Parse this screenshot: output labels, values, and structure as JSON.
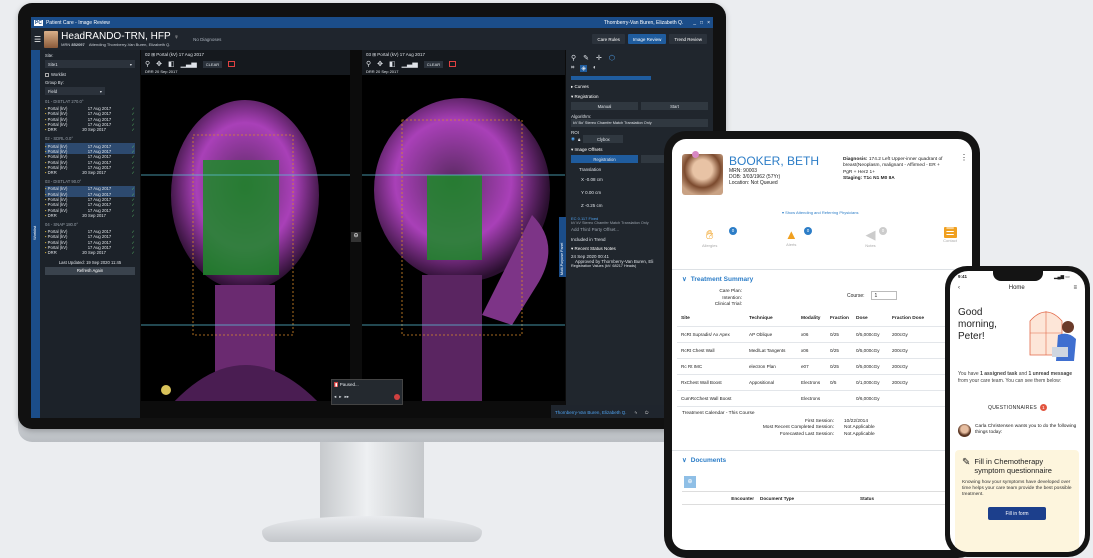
{
  "desktop": {
    "window_title": "Patient Care - Image Review",
    "title_user": "Thornberry-Van Buren, Elizabeth Q.",
    "app_logo": "PC",
    "patient": {
      "name": "HeadRANDO-TRN, HFP",
      "gender_symbol": "♀",
      "mrn_label": "MRN",
      "mrn": "852097",
      "attending_label": "Attending",
      "attending": "Thornberry-Van Buren, Elizabeth Q.",
      "diagnosis": "No Diagnoses"
    },
    "top_tabs": [
      "Care Rules",
      "Image Review",
      "Trend Review"
    ],
    "side": {
      "site_label": "Site:",
      "site_value": "Site1",
      "worklist": "Worklist",
      "group_by_label": "Group By:",
      "group_by_value": "Field",
      "groups": [
        {
          "title": "01 - DISTLAT 270.0°",
          "rows": [
            [
              "Portal (kV)",
              "17 Aug 2017"
            ],
            [
              "Portal (kV)",
              "17 Aug 2017"
            ],
            [
              "Portal (kV)",
              "17 Aug 2017"
            ],
            [
              "Portal (kV)",
              "17 Aug 2017"
            ],
            [
              "DRR",
              "20 Sep 2017"
            ]
          ]
        },
        {
          "title": "02 - SDRL 0.0°",
          "rows": [
            [
              "Portal (kV)",
              "17 Aug 2017"
            ],
            [
              "Portal (kV)",
              "17 Aug 2017"
            ],
            [
              "Portal (kV)",
              "17 Aug 2017"
            ],
            [
              "Portal (kV)",
              "17 Aug 2017"
            ],
            [
              "Portal (kV)",
              "17 Aug 2017"
            ],
            [
              "DRR",
              "20 Sep 2017"
            ]
          ]
        },
        {
          "title": "03 - DISTLAT 90.0°",
          "rows": [
            [
              "Portal (kV)",
              "17 Aug 2017"
            ],
            [
              "Portal (kV)",
              "17 Aug 2017"
            ],
            [
              "Portal (kV)",
              "17 Aug 2017"
            ],
            [
              "Portal (kV)",
              "17 Aug 2017"
            ],
            [
              "Portal (kV)",
              "17 Aug 2017"
            ],
            [
              "DRR",
              "20 Sep 2017"
            ]
          ]
        },
        {
          "title": "04 - SNAP 180.0°",
          "rows": [
            [
              "Portal (kV)",
              "17 Aug 2017"
            ],
            [
              "Portal (kV)",
              "17 Aug 2017"
            ],
            [
              "Portal (kV)",
              "17 Aug 2017"
            ],
            [
              "Portal (kV)",
              "17 Aug 2017"
            ],
            [
              "DRR",
              "20 Sep 2017"
            ]
          ]
        }
      ],
      "last_updated": "Last Updated: 19 Sep 2020 11:45",
      "refresh": "Refresh Again",
      "vertical_tab": "Worklist"
    },
    "viewer_left": {
      "header": "02  ⊞  Portal (kV)  17 Aug 2017",
      "drr": "DRR  20 Sep 2017",
      "clear": "CLEAR"
    },
    "viewer_right": {
      "header": "03  ⊞  Portal (kV)  17 Aug 2017",
      "drr": "DRR  20 Sep 2017",
      "clear": "CLEAR"
    },
    "paused": "Paused...",
    "status_user": "Thornberry-Van Buren, Elizabeth Q.",
    "right": {
      "vertical_tab": "Multi-Purpose Panel",
      "curves": "Curves",
      "registration": "Registration",
      "manual": "Manual",
      "start": "Start",
      "algorithm_label": "Algorithm:",
      "algorithm": "kV Bo' Stereo Chamfer Match Translation Only",
      "roi_label": "ROI",
      "roi_value": "Clybox",
      "image_offsets": "Image Offsets",
      "reg_tab": "Registration",
      "corr_tab": "Correction",
      "translation": "Translation",
      "rotation": "Rot",
      "x": "X  -0.08  cm",
      "y": "Y  0.00  cm",
      "z": "Z  -0.25  cm",
      "ec": "EC 0.117 Fixed",
      "method": "kV kV Stereo Chamfer Match Translation Only",
      "third_party": "Add Third Party Offset...",
      "included": "Included in Trend",
      "recent": "Recent Status Notes",
      "note_date": "24 Sep 2020 00:41",
      "note1": "Approved by Thornberry-Van Buren, Eli",
      "note2": "Registration Values (kV: 68217 Heads)"
    }
  },
  "tablet": {
    "patient_name": "BOOKER, BETH",
    "mrn": "MRN: 90003",
    "dob": "DOB: 3/03/1962 (57Yr)",
    "location": "Location: Not Queued",
    "diagnosis_label": "Diagnosis:",
    "diagnosis": "174.2 Left Upper-inner quadrant of breast(Neoplasm, malignant - Affirmed - ER +",
    "pgr": "PgR + Her2 1+",
    "staging_label": "Staging:",
    "staging": "T1c N1 M0 IIA",
    "show_attending": "▾ Show Attending and Referring Physicians",
    "icon_labels": [
      "Allergies",
      "Alerts",
      "Notes",
      "Contact"
    ],
    "icon_counts": [
      "0",
      "0",
      "0",
      "0"
    ],
    "treatment_summary": "Treatment Summary",
    "care_plan": "Care Plan:",
    "intention": "Intention:",
    "clinical_trial": "Clinical Trial:",
    "course_label": "Course:",
    "course_value": "1",
    "table": {
      "headers": [
        "Site",
        "Technique",
        "Modality",
        "Fraction",
        "Dose",
        "Fraction Dose"
      ],
      "rows": [
        [
          "RcRt Supradis/ Ax Apex",
          "AP Oblique",
          "x06",
          "0/25",
          "0/5,000cGy",
          "200cGy"
        ],
        [
          "RcRt Chest Wall",
          "Med/Lat Tangents",
          "x06",
          "0/25",
          "0/5,000cGy",
          "200cGy"
        ],
        [
          "Rc Rt IMC",
          "electron Plan",
          "e07",
          "0/25",
          "0/5,000cGy",
          "200cGy"
        ],
        [
          "RxChest Wall Boost",
          "Appositional",
          "Electrons",
          "0/5",
          "0/1,000cGy",
          "200cGy"
        ],
        [
          "CumRcChest Wall Boost",
          "",
          "Electrons",
          "",
          "0/6,000cGy",
          ""
        ]
      ]
    },
    "calendar_title": "Treatment Calendar - This Course",
    "first_session_label": "First Session:",
    "first_session": "10/22/2014",
    "recent_label": "Most Recent Completed Session:",
    "recent": "Not Applicable",
    "forecast_label": "Forecasted Last Session:",
    "forecast": "Not Applicable",
    "documents": "Documents",
    "doc_headers": [
      "Encounter",
      "Document Type",
      "Status"
    ],
    "add_icon": "⊕"
  },
  "phone": {
    "time": "9:41",
    "title": "Home",
    "greeting": "Good morning, Peter!",
    "task_text_1": "You have ",
    "task_bold_1": "1 assigned task",
    "task_text_2": " and ",
    "task_bold_2": "1 unread message",
    "task_text_3": " from your care team. You can see them below:",
    "questionnaires": "QUESTIONNAIRES",
    "q_count": "1",
    "from_text": "Carla Christensen wants you to do the following things today:",
    "from_name": "Carla Christensen",
    "card_title": "Fill in Chemotherapy symptom questionnaire",
    "card_body": "Knowing how your symptoms have developed over time helps your care team provide the best possible treatment.",
    "button": "Fill in form"
  },
  "colors": {
    "accent": "#1b4d89",
    "link_blue": "#2c7dc7",
    "tab_active": "#1f5c9e",
    "check_green": "#5bc46a",
    "alert_orange": "#f0a020"
  }
}
